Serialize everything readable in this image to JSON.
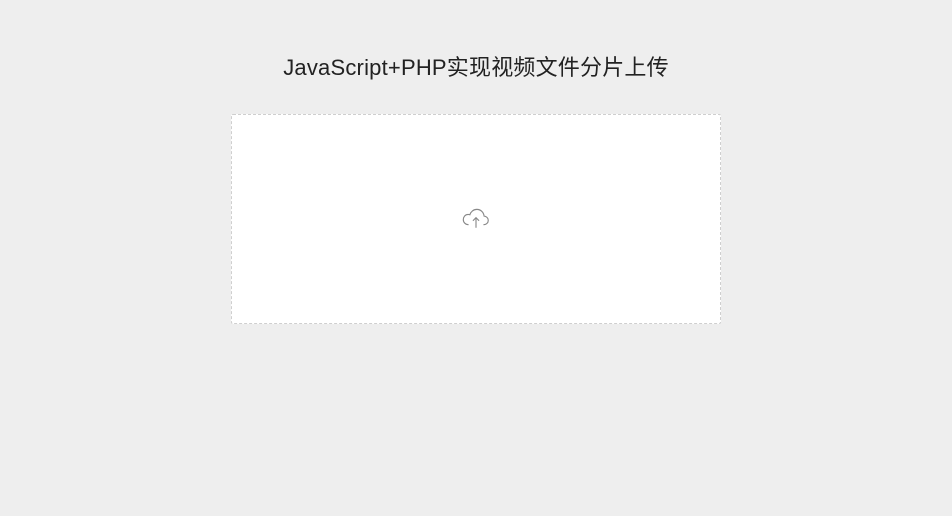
{
  "header": {
    "title": "JavaScript+PHP实现视频文件分片上传"
  },
  "upload": {
    "icon_name": "cloud-upload-icon"
  }
}
